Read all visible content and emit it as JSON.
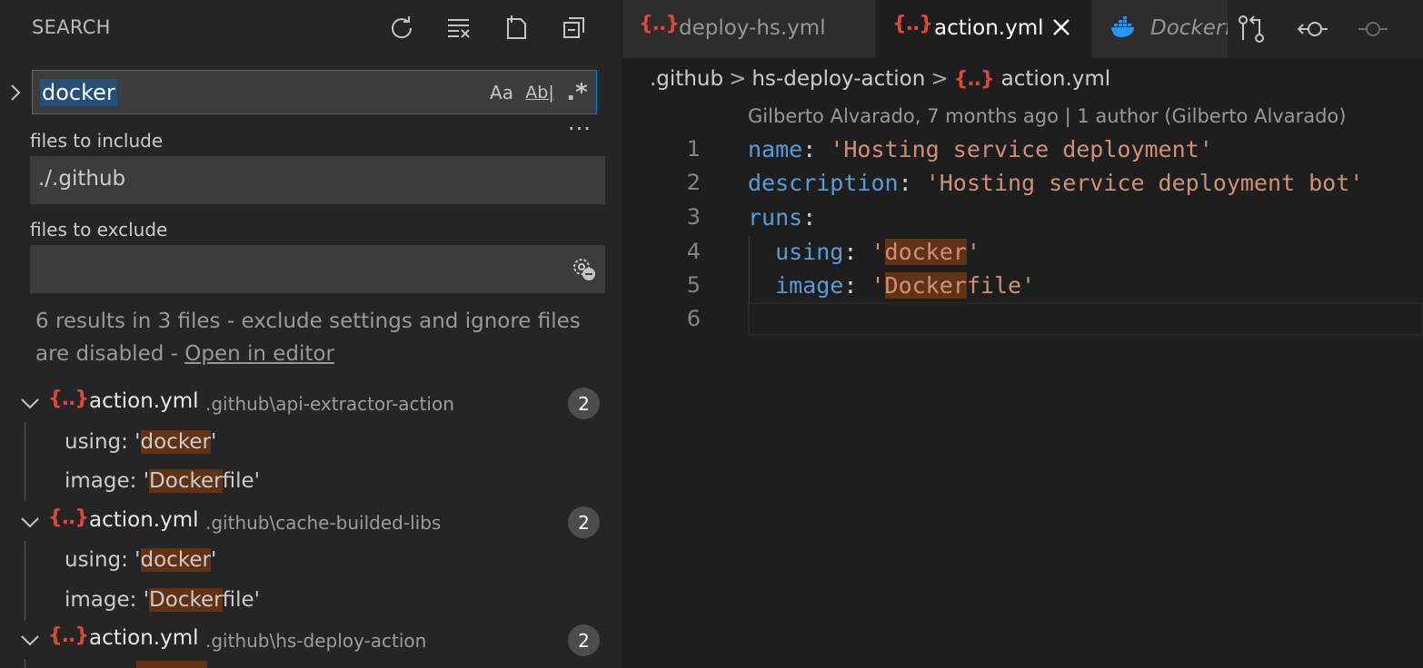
{
  "sidebar": {
    "title": "SEARCH",
    "toolbar_icons": [
      "refresh-icon",
      "clear-results-icon",
      "new-search-editor-icon",
      "collapse-all-icon"
    ],
    "search": {
      "value": "docker",
      "options": {
        "match_case": "Aa",
        "whole_word": "Ab|",
        "regex": ".*"
      }
    },
    "include": {
      "label": "files to include",
      "value": "./.github"
    },
    "exclude": {
      "label": "files to exclude",
      "value": ""
    },
    "summary": "6 results in 3 files - exclude settings and ignore files are disabled - ",
    "open_in_editor": "Open in editor",
    "results": [
      {
        "file": "action.yml",
        "path": ".github\\api-extractor-action",
        "count": "2",
        "matches": [
          {
            "pre": "using: '",
            "hit": "docker",
            "post": "'"
          },
          {
            "pre": "image: '",
            "hit": "Docker",
            "post": "file'"
          }
        ]
      },
      {
        "file": "action.yml",
        "path": ".github\\cache-builded-libs",
        "count": "2",
        "matches": [
          {
            "pre": "using: '",
            "hit": "docker",
            "post": "'"
          },
          {
            "pre": "image: '",
            "hit": "Docker",
            "post": "file'"
          }
        ]
      },
      {
        "file": "action.yml",
        "path": ".github\\hs-deploy-action",
        "count": "2",
        "matches": []
      }
    ]
  },
  "editor": {
    "tabs": [
      {
        "label": "deploy-hs.yml",
        "icon": "yaml-braces-icon",
        "active": false
      },
      {
        "label": "action.yml",
        "icon": "yaml-braces-icon",
        "active": true
      },
      {
        "label": "Dockerfile",
        "icon": "docker-whale-icon",
        "active": false
      }
    ],
    "json_glyph": "{..}",
    "breadcrumb": [
      ".github",
      "hs-deploy-action",
      "action.yml"
    ],
    "blame": "Gilberto Alvarado, 7 months ago | 1 author (Gilberto Alvarado)",
    "lines": [
      {
        "n": "1",
        "key": "name",
        "colon": ": ",
        "str": "'Hosting service deployment'"
      },
      {
        "n": "2",
        "key": "description",
        "colon": ": ",
        "str": "'Hosting service deployment bot'"
      },
      {
        "n": "3",
        "key": "runs",
        "colon": ":",
        "str": ""
      },
      {
        "n": "4",
        "key": "  using",
        "colon": ": ",
        "str_pre": "'",
        "str_hit": "docker",
        "str_post": "'"
      },
      {
        "n": "5",
        "key": "  image",
        "colon": ": ",
        "str_pre": "'",
        "str_hit": "Docker",
        "str_post": "file'"
      },
      {
        "n": "6",
        "key": "",
        "colon": "",
        "str": ""
      }
    ],
    "actions": [
      "compare-changes-icon",
      "go-back-icon",
      "go-forward-icon"
    ]
  }
}
